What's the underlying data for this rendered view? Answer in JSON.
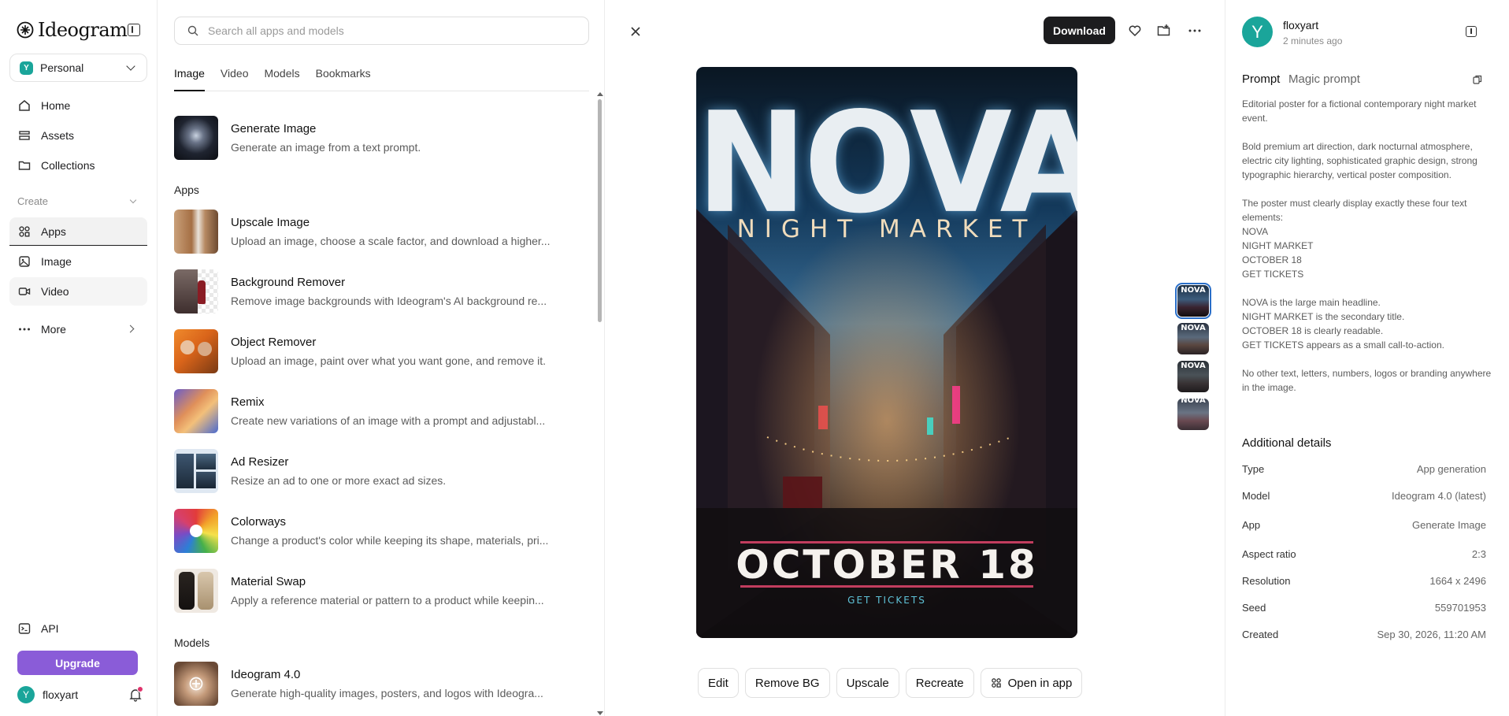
{
  "sidebar": {
    "brand": "Ideogram",
    "workspace": {
      "badge": "Y",
      "label": "Personal"
    },
    "nav": {
      "home": "Home",
      "assets": "Assets",
      "collections": "Collections"
    },
    "create_label": "Create",
    "create_items": {
      "apps": "Apps",
      "image": "Image",
      "video": "Video"
    },
    "more": "More",
    "api": "API",
    "upgrade": "Upgrade",
    "user": {
      "initial": "Y",
      "name": "floxyart"
    }
  },
  "apps_panel": {
    "search_placeholder": "Search all apps and models",
    "tabs": [
      "Image",
      "Video",
      "Models",
      "Bookmarks"
    ],
    "featured": {
      "name": "Generate Image",
      "desc": "Generate an image from a text prompt."
    },
    "apps_heading": "Apps",
    "apps": [
      {
        "name": "Upscale Image",
        "desc": "Upload an image, choose a scale factor, and download a higher..."
      },
      {
        "name": "Background Remover",
        "desc": "Remove image backgrounds with Ideogram's AI background re..."
      },
      {
        "name": "Object Remover",
        "desc": "Upload an image, paint over what you want gone, and remove it."
      },
      {
        "name": "Remix",
        "desc": "Create new variations of an image with a prompt and adjustabl..."
      },
      {
        "name": "Ad Resizer",
        "desc": "Resize an ad to one or more exact ad sizes."
      },
      {
        "name": "Colorways",
        "desc": "Change a product's color while keeping its shape, materials, pri..."
      },
      {
        "name": "Material Swap",
        "desc": "Apply a reference material or pattern to a product while keepin..."
      }
    ],
    "models_heading": "Models",
    "models": [
      {
        "name": "Ideogram 4.0",
        "desc": "Generate high-quality images, posters, and logos with Ideogra..."
      }
    ]
  },
  "viewer": {
    "download": "Download",
    "poster": {
      "headline": "NOVA",
      "subtitle": "NIGHT MARKET",
      "date": "OCTOBER 18",
      "cta": "GET TICKETS"
    },
    "thumb_labels": [
      "NOVA",
      "NOVA",
      "NOVA",
      "NOVA"
    ],
    "actions": {
      "edit": "Edit",
      "remove_bg": "Remove BG",
      "upscale": "Upscale",
      "recreate": "Recreate",
      "open_in_app": "Open in app"
    }
  },
  "details": {
    "user_initial": "Y",
    "username": "floxyart",
    "time": "2 minutes ago",
    "tab_prompt": "Prompt",
    "tab_magic": "Magic prompt",
    "prompt": "Editorial poster for a fictional contemporary night market event.\n\nBold premium art direction, dark nocturnal atmosphere, electric city lighting, sophisticated graphic design, strong typographic hierarchy, vertical poster composition.\n\nThe poster must clearly display exactly these four text elements:\nNOVA\nNIGHT MARKET\nOCTOBER 18\nGET TICKETS\n\nNOVA is the large main headline.\nNIGHT MARKET is the secondary title.\nOCTOBER 18 is clearly readable.\nGET TICKETS appears as a small call-to-action.\n\nNo other text, letters, numbers, logos or branding anywhere in the image.",
    "additional_title": "Additional details",
    "rows": [
      {
        "key": "Type",
        "value": "App generation"
      },
      {
        "key": "Model",
        "value": "Ideogram 4.0 (latest)"
      },
      {
        "key": "App",
        "value": "Generate Image"
      },
      {
        "key": "Aspect ratio",
        "value": "2:3"
      },
      {
        "key": "Resolution",
        "value": "1664 x 2496"
      },
      {
        "key": "Seed",
        "value": "559701953"
      },
      {
        "key": "Created",
        "value": "Sep 30, 2026, 11:20 AM"
      }
    ]
  },
  "colors": {
    "accent_purple": "#8a5cd8",
    "avatar_teal": "#1aa59a",
    "download_black": "#1c1c1e",
    "notification_pink": "#e0336b"
  }
}
